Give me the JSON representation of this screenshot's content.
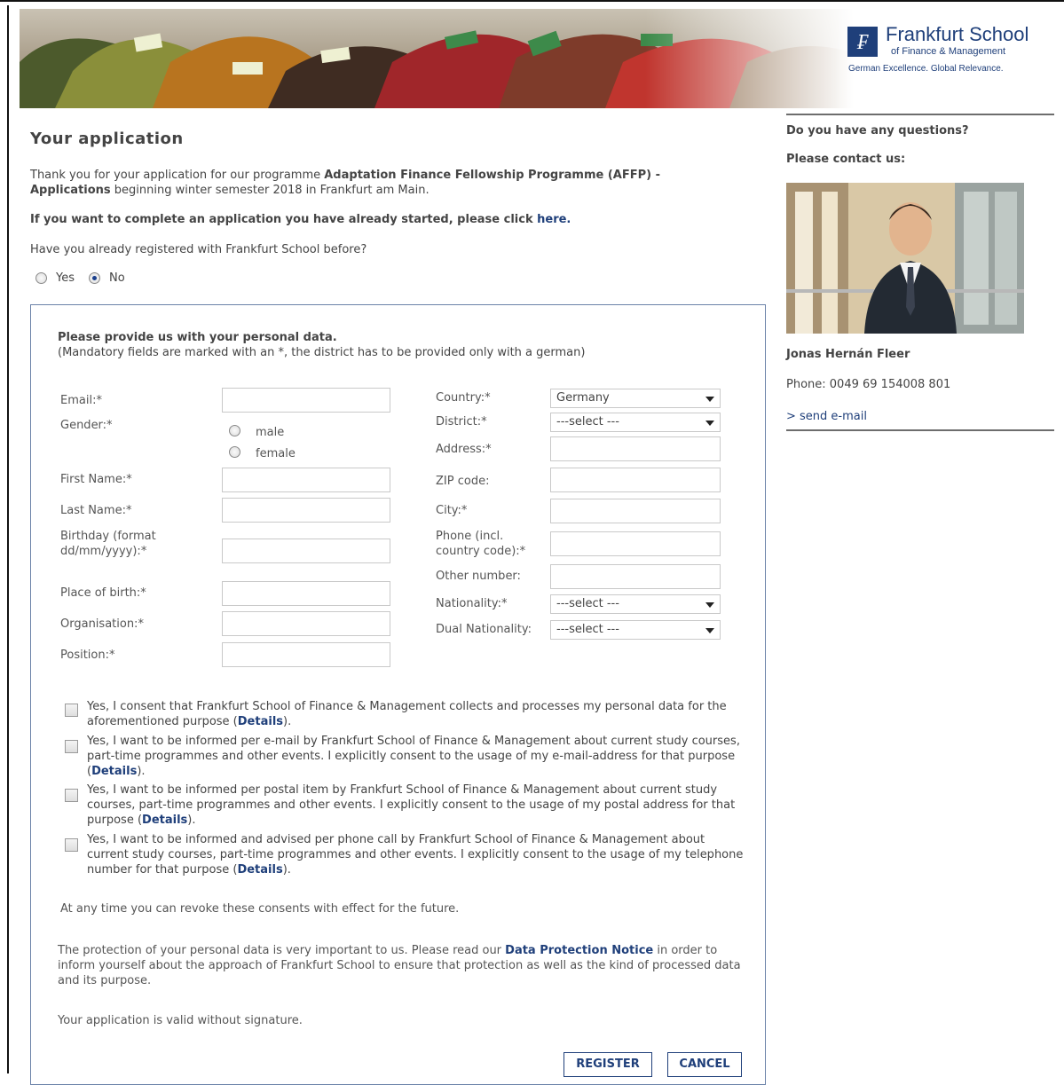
{
  "brand": {
    "name": "Frankfurt School",
    "subtitle": "of Finance & Management",
    "tagline": "German Excellence. Global Relevance."
  },
  "page": {
    "title": "Your application",
    "intro_prefix": "Thank you for your application for our programme ",
    "intro_programme": "Adaptation Finance Fellowship Programme (AFFP) - Applications",
    "intro_suffix": " beginning winter semester 2018 in Frankfurt am Main.",
    "continue_text": "If you want to complete an application you have already started, please click ",
    "continue_link": "here.",
    "registered_question": "Have you already registered with Frankfurt School before?",
    "registered_options": [
      "Yes",
      "No"
    ],
    "registered_selected": "No"
  },
  "form": {
    "title": "Please provide us with your personal data.",
    "note": "(Mandatory fields are marked with an *, the district has to be provided only with a german)",
    "labels": {
      "email": "Email:*",
      "gender": "Gender:*",
      "gender_male": "male",
      "gender_female": "female",
      "first_name": "First Name:*",
      "last_name": "Last Name:*",
      "birthday": "Birthday (format dd/mm/yyyy):*",
      "place_of_birth": "Place of birth:*",
      "organisation": "Organisation:*",
      "position": "Position:*",
      "country": "Country:*",
      "district": "District:*",
      "address": "Address:*",
      "zip": "ZIP code:",
      "city": "City:*",
      "phone": "Phone (incl. country code):*",
      "other_number": "Other number:",
      "nationality": "Nationality:*",
      "dual_nationality": "Dual Nationality:"
    },
    "values": {
      "country": "Germany",
      "district": "---select ---",
      "nationality": "---select ---",
      "dual_nationality": "---select ---"
    },
    "consents": [
      {
        "text": "Yes, I consent that Frankfurt School of Finance & Management collects and processes my personal data for the aforementioned purpose (",
        "link": "Details",
        "end": ")."
      },
      {
        "text": "Yes, I want to be informed per e-mail by Frankfurt School of Finance & Management about current study courses, part-time programmes and other events. I explicitly consent to the usage of my e-mail-address for that purpose (",
        "link": "Details",
        "end": ")."
      },
      {
        "text": "Yes, I want to be informed per postal item by Frankfurt School of Finance & Management about current study courses, part-time programmes and other events. I explicitly consent to the usage of my postal address for that purpose (",
        "link": "Details",
        "end": ")."
      },
      {
        "text": "Yes, I want to be informed and advised per phone call by Frankfurt School of Finance & Management about current study courses, part-time programmes and other events. I explicitly consent to the usage of my telephone number for that purpose (",
        "link": "Details",
        "end": ")."
      }
    ],
    "revoke_text": "At any time you can revoke these consents with effect for the future.",
    "protection_prefix": "The protection of your personal data is very important to us. Please read our ",
    "protection_link": "Data Protection Notice",
    "protection_suffix": " in order to inform yourself about the approach of Frankfurt School to ensure that protection as well as the kind of processed data and its purpose.",
    "signature_text": "Your application is valid without signature.",
    "register_label": "REGISTER",
    "cancel_label": "CANCEL"
  },
  "sidebar": {
    "question": "Do you have any questions?",
    "contact": "Please contact us:",
    "name": "Jonas Hernán Fleer",
    "phone": "Phone: 0049 69 154008 801",
    "mail_link": "> send e-mail"
  }
}
